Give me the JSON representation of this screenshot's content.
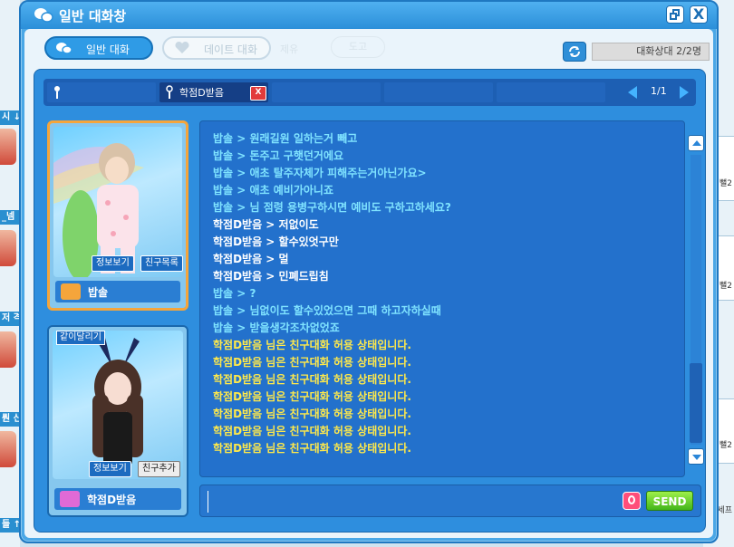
{
  "window": {
    "title": "일반 대화창",
    "close_glyph": "X"
  },
  "tabs": [
    {
      "label": "일반 대화",
      "active": true
    },
    {
      "label": "데이트 대화",
      "active": false
    }
  ],
  "faded_labels": [
    "제유",
    "도고"
  ],
  "status": {
    "text": "대화상대 2/2명"
  },
  "partner_tabs": [
    {
      "name": "",
      "selected": false
    },
    {
      "name": "학점D받음",
      "selected": true,
      "close_glyph": "X"
    },
    {
      "name": "",
      "selected": false
    },
    {
      "name": "",
      "selected": false
    },
    {
      "name": "",
      "selected": false
    }
  ],
  "pagination": {
    "text": "1/1"
  },
  "profiles": [
    {
      "name": "밥솔",
      "info_button": "정보보기",
      "friend_button": "친구목록"
    },
    {
      "name": "학점D받음",
      "info_button": "정보보기",
      "friend_button": "친구추가",
      "ribbon": "같이달리기"
    }
  ],
  "messages": [
    {
      "text": "밥솔 > 원래길원 일하는거 빼고",
      "color": "cyan"
    },
    {
      "text": "밥솔 > 돈주고 구햇던거에요",
      "color": "cyan"
    },
    {
      "text": "밥솔 > 애초 탈주자체가 피해주는거아닌가요>",
      "color": "cyan"
    },
    {
      "text": "밥솔 > 애초 예비가아니죠",
      "color": "cyan"
    },
    {
      "text": "밥솔 > 님 점령 용병구하시면 예비도 구하고하세요?",
      "color": "cyan"
    },
    {
      "text": "학점D받음 > 저없이도",
      "color": "white"
    },
    {
      "text": "학점D받음 > 할수있엇구만",
      "color": "white"
    },
    {
      "text": "학점D받음 > 멀",
      "color": "white"
    },
    {
      "text": "학점D받음 > 민폐드립침",
      "color": "white"
    },
    {
      "text": "밥솔 > ?",
      "color": "cyan"
    },
    {
      "text": "밥솔 > 님없이도 할수있었으면 그때 하고자하실때",
      "color": "cyan"
    },
    {
      "text": "밥솔 > 받을생각조차없었죠",
      "color": "cyan"
    },
    {
      "text": "학점D받음 님은 친구대화 허용 상태입니다.",
      "color": "yellow"
    },
    {
      "text": "학점D받음 님은 친구대화 허용 상태입니다.",
      "color": "yellow"
    },
    {
      "text": "학점D받음 님은 친구대화 허용 상태입니다.",
      "color": "yellow"
    },
    {
      "text": "학점D받음 님은 친구대화 허용 상태입니다.",
      "color": "yellow"
    },
    {
      "text": "학점D받음 님은 친구대화 허용 상태입니다.",
      "color": "yellow"
    },
    {
      "text": "학점D받음 님은 친구대화 허용 상태입니다.",
      "color": "yellow"
    },
    {
      "text": "학점D받음 님은 친구대화 허용 상태입니다.",
      "color": "yellow"
    }
  ],
  "input": {
    "value": ""
  },
  "send_label": "SEND",
  "background": {
    "left_tags": [
      "시 ↓",
      "_넴",
      "저 격",
      "뤈 신",
      "들 ↑"
    ],
    "right_badges": [
      "뻘2",
      "뻘2",
      "뻘2",
      "세프"
    ]
  },
  "colors": {
    "accent": "#2f9be6",
    "chat_cyan": "#7fe3ff",
    "chat_yellow": "#ffe94a",
    "send_green": "#43b51a"
  }
}
